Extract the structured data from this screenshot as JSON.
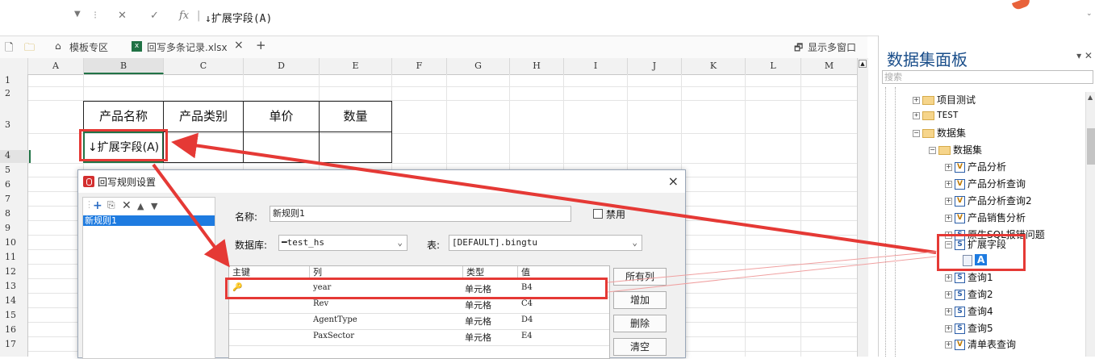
{
  "formula_bar": {
    "dropdown_icon": "chevron-down-icon",
    "cancel_icon": "close-icon",
    "confirm_icon": "check-icon",
    "fx_label": "fx",
    "formula": "↓扩展字段(A)"
  },
  "tabs": {
    "template_area": "模板专区",
    "file_name": "回写多条记录.xlsx",
    "close": "×",
    "add": "+",
    "multi_window": "显示多窗口"
  },
  "grid": {
    "columns": [
      "A",
      "B",
      "C",
      "D",
      "E",
      "F",
      "G",
      "H",
      "I",
      "J",
      "K",
      "L",
      "M"
    ],
    "rows": [
      "1",
      "2",
      "3",
      "4",
      "5",
      "6",
      "7",
      "8",
      "9",
      "10",
      "11",
      "12",
      "13",
      "14",
      "15",
      "16",
      "17"
    ]
  },
  "sheet_table": {
    "headers": [
      "产品名称",
      "产品类别",
      "单价",
      "数量"
    ],
    "expand_cell": "↓扩展字段(A)"
  },
  "dialog": {
    "title": "回写规则设置",
    "close": "×",
    "rule_item": "新规则1",
    "name_label": "名称:",
    "name_value": "新规则1",
    "disable_label": "禁用",
    "db_label": "数据库:",
    "db_value": "━test_hs",
    "table_label": "表:",
    "table_value": "[DEFAULT].bingtu",
    "table_headers": [
      "主键",
      "列",
      "类型",
      "值"
    ],
    "rows": [
      {
        "col": "year",
        "type": "单元格",
        "val": "B4"
      },
      {
        "col": "Rev",
        "type": "单元格",
        "val": "C4"
      },
      {
        "col": "AgentType",
        "type": "单元格",
        "val": "D4"
      },
      {
        "col": "PaxSector",
        "type": "单元格",
        "val": "E4"
      }
    ],
    "buttons": {
      "all_cols": "所有列",
      "add": "增加",
      "delete": "删除",
      "clear": "清空"
    }
  },
  "panel": {
    "title": "数据集面板",
    "search_placeholder": "搜索",
    "tree": [
      {
        "label": "项目测试"
      },
      {
        "label": "TEST"
      },
      {
        "label": "数据集"
      },
      {
        "label": "数据集"
      },
      {
        "label": "产品分析"
      },
      {
        "label": "产品分析查询"
      },
      {
        "label": "产品分析查询2"
      },
      {
        "label": "产品销售分析"
      },
      {
        "label": "原生SQL报错问题"
      },
      {
        "label": "扩展字段"
      },
      {
        "label": "A"
      },
      {
        "label": "查询1"
      },
      {
        "label": "查询2"
      },
      {
        "label": "查询4"
      },
      {
        "label": "查询5"
      },
      {
        "label": "清单表查询"
      }
    ]
  },
  "colors": {
    "highlight": "#e53935",
    "accent": "#1e7be0",
    "panel_title": "#1a4e8a"
  }
}
